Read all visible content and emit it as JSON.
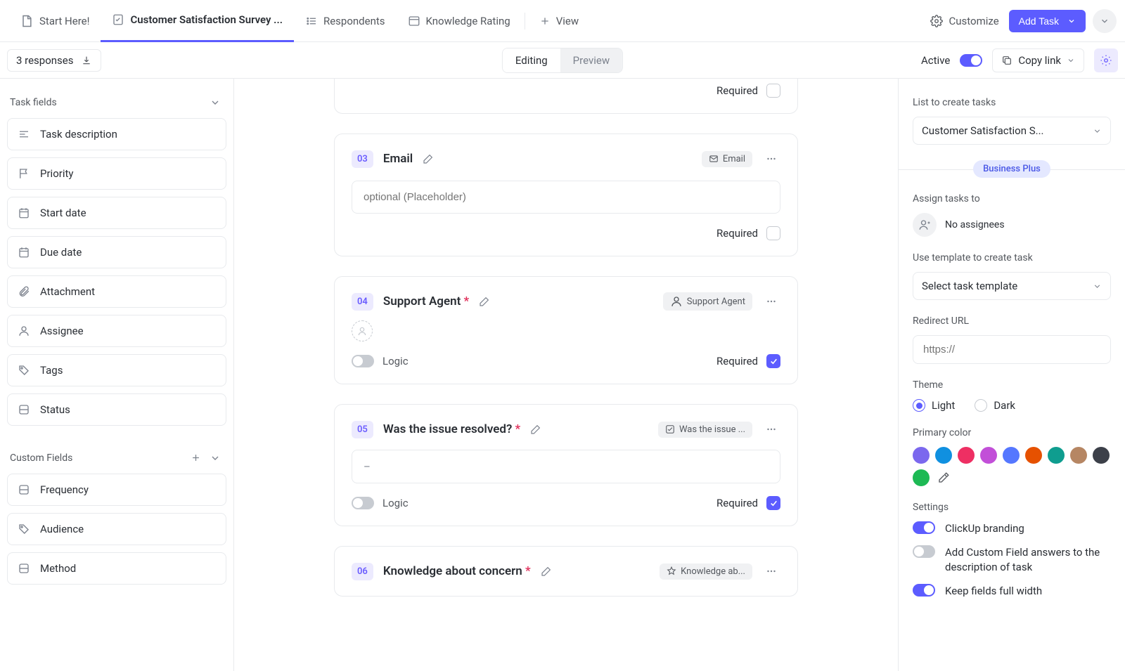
{
  "tabs": {
    "start": "Start Here!",
    "survey": "Customer Satisfaction Survey ...",
    "respondents": "Respondents",
    "knowledge": "Knowledge Rating",
    "view": "View"
  },
  "toolbar": {
    "customize": "Customize",
    "add_task": "Add Task"
  },
  "subbar": {
    "responses": "3 responses",
    "editing": "Editing",
    "preview": "Preview",
    "active": "Active",
    "copy_link": "Copy link"
  },
  "left": {
    "task_fields_header": "Task fields",
    "task_fields": [
      {
        "icon": "text",
        "label": "Task description"
      },
      {
        "icon": "flag",
        "label": "Priority"
      },
      {
        "icon": "calendar",
        "label": "Start date"
      },
      {
        "icon": "calendar",
        "label": "Due date"
      },
      {
        "icon": "clip",
        "label": "Attachment"
      },
      {
        "icon": "person",
        "label": "Assignee"
      },
      {
        "icon": "tag",
        "label": "Tags"
      },
      {
        "icon": "status",
        "label": "Status"
      }
    ],
    "custom_fields_header": "Custom Fields",
    "custom_fields": [
      {
        "icon": "status",
        "label": "Frequency"
      },
      {
        "icon": "tag",
        "label": "Audience"
      },
      {
        "icon": "status",
        "label": "Method"
      }
    ]
  },
  "center": {
    "required": "Required",
    "logic": "Logic",
    "placeholder": "optional (Placeholder)",
    "dash": "–",
    "cards": [
      {
        "num": "03",
        "title": "Email",
        "required_star": false,
        "chip_icon": "mail",
        "chip_label": "Email",
        "has_placeholder": true,
        "has_logic": false,
        "required": false,
        "partial": true,
        "body": "placeholder"
      },
      {
        "num": "04",
        "title": "Support Agent",
        "required_star": true,
        "chip_icon": "person",
        "chip_label": "Support Agent",
        "has_placeholder": false,
        "has_logic": true,
        "required": true,
        "partial": false,
        "body": "assignee"
      },
      {
        "num": "05",
        "title": "Was the issue resolved?",
        "required_star": true,
        "chip_icon": "check",
        "chip_label": "Was the issue ...",
        "has_placeholder": false,
        "has_logic": true,
        "required": true,
        "partial": false,
        "body": "dash"
      },
      {
        "num": "06",
        "title": "Knowledge about concern",
        "required_star": true,
        "chip_icon": "star",
        "chip_label": "Knowledge ab...",
        "has_placeholder": false,
        "has_logic": false,
        "required": false,
        "partial": false,
        "body": "none"
      }
    ]
  },
  "right": {
    "list_label": "List to create tasks",
    "list_value": "Customer Satisfaction S...",
    "business_plus": "Business Plus",
    "assign_label": "Assign tasks to",
    "assign_value": "No assignees",
    "template_label": "Use template to create task",
    "template_value": "Select task template",
    "redirect_label": "Redirect URL",
    "redirect_placeholder": "https://",
    "theme_label": "Theme",
    "theme_light": "Light",
    "theme_dark": "Dark",
    "primary_label": "Primary color",
    "colors": [
      "#7b68ee",
      "#1090e0",
      "#ee2f63",
      "#c24fd8",
      "#5577ff",
      "#e65100",
      "#0f9d8f",
      "#b68663",
      "#3c4049",
      "#1db954"
    ],
    "settings_label": "Settings",
    "settings": [
      {
        "label": "ClickUp branding",
        "on": true
      },
      {
        "label": "Add Custom Field answers to the description of task",
        "on": false
      },
      {
        "label": "Keep fields full width",
        "on": true
      }
    ]
  }
}
